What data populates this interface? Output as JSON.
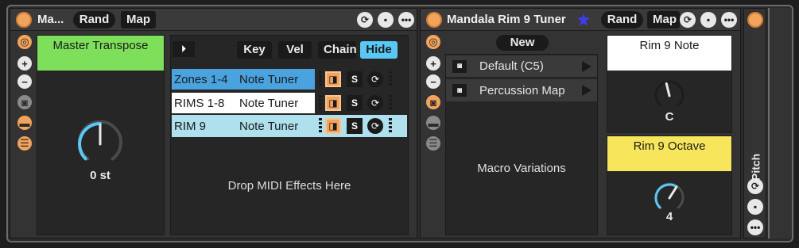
{
  "colors": {
    "accent_orange": "#f2a35c",
    "green_header": "#7ee05a",
    "blue_selected": "#4aa3df",
    "light_blue": "#aee0ee",
    "yellow_header": "#f7e65c",
    "blue_dot": "#3c3cf0"
  },
  "device1": {
    "title": "Ma...",
    "rand_label": "Rand",
    "map_label": "Map",
    "macro": {
      "name": "Master Transpose",
      "value_label": "0 st",
      "value_fraction": 0.5
    },
    "chain_buttons": {
      "play_icon": "play-toggle-icon",
      "key_label": "Key",
      "vel_label": "Vel",
      "chain_label": "Chain",
      "hide_label": "Hide"
    },
    "chains": [
      {
        "name": "Zones 1-4",
        "device": "Note Tuner",
        "solo": "S"
      },
      {
        "name": "RIMS 1-8",
        "device": "Note Tuner",
        "solo": "S"
      },
      {
        "name": "RIM 9",
        "device": "Note Tuner",
        "solo": "S"
      }
    ],
    "drop_hint": "Drop MIDI Effects Here"
  },
  "device2": {
    "title": "Mandala Rim 9 Tuner",
    "rand_label": "Rand",
    "map_label": "Map",
    "new_label": "New",
    "variations": [
      {
        "name": "Default (C5)"
      },
      {
        "name": "Percussion Map"
      }
    ],
    "variations_label": "Macro Variations",
    "macro1": {
      "name": "Rim 9 Note",
      "value_label": "C",
      "value_fraction": 0.45
    },
    "macro2": {
      "name": "Rim 9 Octave",
      "value_label": "4",
      "value_fraction": 0.62
    }
  },
  "device3": {
    "label": "Pitch"
  }
}
